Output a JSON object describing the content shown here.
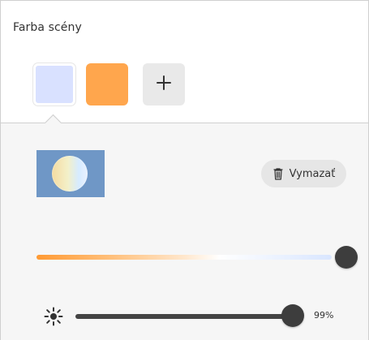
{
  "panel": {
    "title": "Farba scény"
  },
  "swatches": [
    {
      "color": "#d9e1ff",
      "selected": true
    },
    {
      "color": "#ffa64d",
      "selected": false
    }
  ],
  "add_button": {
    "icon": "plus-icon"
  },
  "scene": {
    "thumbnail": {
      "background_color": "#6f97c6"
    },
    "delete_button": {
      "label": "Vymazať",
      "icon": "trash-icon"
    }
  },
  "color_slider": {
    "value": 1.0,
    "gradient": [
      "#ff9a33",
      "#ffbf7a",
      "#ffe7cc",
      "#ffffff",
      "#d9e6ff"
    ]
  },
  "brightness": {
    "icon": "sun-icon",
    "value_percent": 99,
    "label": "99%"
  }
}
